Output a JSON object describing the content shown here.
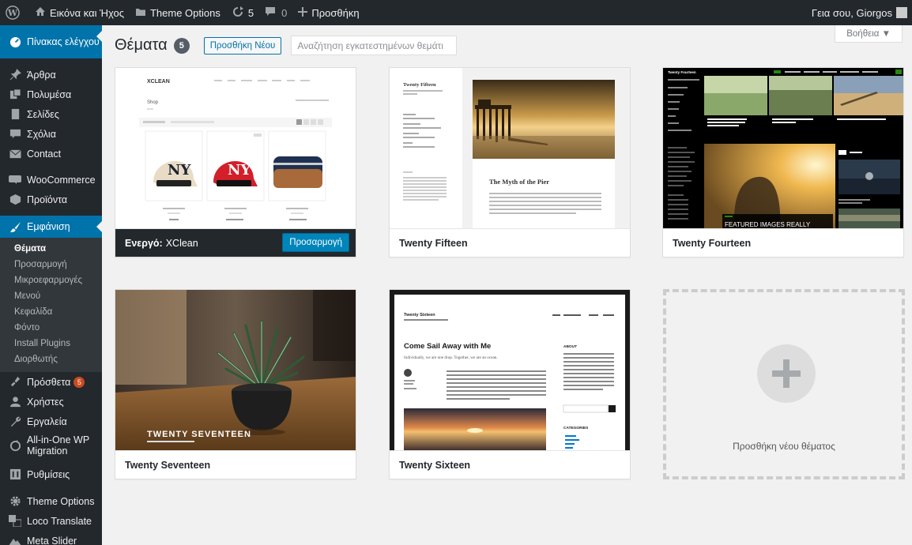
{
  "admin_bar": {
    "site_name": "Εικόνα και Ήχος",
    "theme_options": "Theme Options",
    "updates_count": "5",
    "comments_count": "0",
    "new_label": "Προσθήκη",
    "greeting": "Γεια σου, Giorgos"
  },
  "sidebar": {
    "dashboard": "Πίνακας ελέγχου",
    "posts": "Άρθρα",
    "media": "Πολυμέσα",
    "pages": "Σελίδες",
    "comments": "Σχόλια",
    "contact": "Contact",
    "woocommerce": "WooCommerce",
    "products": "Προϊόντα",
    "appearance": "Εμφάνιση",
    "appearance_sub": [
      "Θέματα",
      "Προσαρμογή",
      "Μικροεφαρμογές",
      "Μενού",
      "Κεφαλίδα",
      "Φόντο",
      "Install Plugins",
      "Διορθωτής"
    ],
    "plugins": "Πρόσθετα",
    "plugins_count": "5",
    "users": "Χρήστες",
    "tools": "Εργαλεία",
    "migration_line1": "All-in-One WP",
    "migration_line2": "Migration",
    "settings": "Ρυθμίσεις",
    "theme_options": "Theme Options",
    "loco": "Loco Translate",
    "meta_slider": "Meta Slider"
  },
  "main": {
    "help": "Βοήθεια ▼",
    "title": "Θέματα",
    "theme_count": "5",
    "add_new": "Προσθήκη Νέου",
    "search_placeholder": "Αναζήτηση εγκατεστημένων θεμάτι",
    "active_prefix": "Ενεργό:",
    "customize": "Προσαρμογή",
    "add_theme_label": "Προσθήκη νέου θέματος"
  },
  "themes": [
    {
      "name": "XClean",
      "active": true
    },
    {
      "name": "Twenty Fifteen"
    },
    {
      "name": "Twenty Fourteen"
    },
    {
      "name": "Twenty Seventeen"
    },
    {
      "name": "Twenty Sixteen"
    }
  ],
  "previews": {
    "xclean_logo": "XCLEAN",
    "xclean_heading": "Shop",
    "tf_title": "Twenty Fifteen",
    "tf_post_title": "The Myth of the Pier",
    "t4_title": "Twenty Fourteen",
    "t4_featured": "FEATURED IMAGES REALLY",
    "t17_title": "TWENTY SEVENTEEN",
    "t16_title": "Twenty Sixteen",
    "t16_post_title": "Come Sail Away with Me",
    "t16_excerpt": "Individually, we are one drop. Together, we are an ocean.",
    "t16_about": "ABOUT",
    "t16_categories": "CATEGORIES"
  },
  "colors": {
    "admin_bg": "#23282d",
    "accent": "#0073aa",
    "badge": "#ca4a1f"
  }
}
